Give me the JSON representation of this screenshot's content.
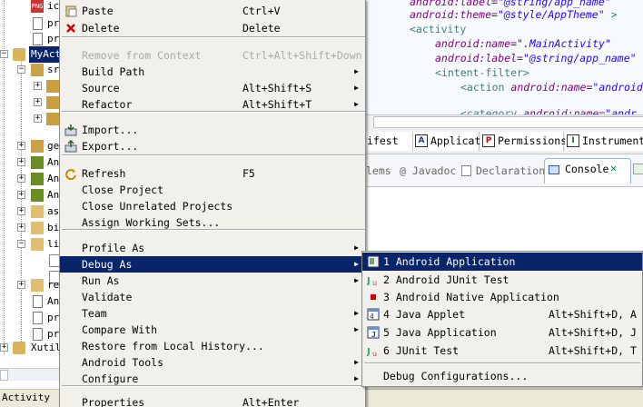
{
  "explorer": {
    "rows": [
      "ic",
      "pr",
      "pr",
      "MyAct",
      "sr",
      "",
      "",
      "",
      "ge",
      "An",
      "An",
      "An",
      "as",
      "bi",
      "li",
      "",
      "",
      "re",
      "An",
      "pr",
      "pr",
      "Xutil"
    ],
    "status_text": "Activity"
  },
  "editor": {
    "lines": [
      {
        "attr": "android:label=",
        "val": "\"@string/app_name\""
      },
      {
        "attr": "android:theme=",
        "val": "\"@style/AppTheme\"",
        "tail": " >"
      },
      {
        "tag": "<activity"
      },
      {
        "attr": "android:name=",
        "val": "\".MainActivity\""
      },
      {
        "attr": "android:label=",
        "val": "\"@string/app_name\"",
        "tail": " >"
      },
      {
        "tag": "<intent-filter>"
      },
      {
        "tag": "<action ",
        "attr": "android:name=",
        "val": "\"android"
      },
      {
        "tag": ""
      },
      {
        "tag": "<category ",
        "attr": "android:name=",
        "val": "\"andr"
      }
    ]
  },
  "manifest_tabs": [
    {
      "label": "ifest",
      "icon": ""
    },
    {
      "label": "Application",
      "icon": "A"
    },
    {
      "label": "Permissions",
      "icon": "P"
    },
    {
      "label": "Instrumentat",
      "icon": "I"
    }
  ],
  "console_tabs": [
    {
      "label": "lems"
    },
    {
      "label": "@ Javadoc"
    },
    {
      "label": "Declaration"
    },
    {
      "label": "Console"
    }
  ],
  "context_menu": {
    "items": [
      {
        "label": "Paste",
        "accel": "Ctrl+V",
        "icon": "paste-icon"
      },
      {
        "label": "Delete",
        "accel": "Delete",
        "icon": "delete-icon"
      },
      {
        "sep": true
      },
      {
        "label": "Remove from Context",
        "accel": "Ctrl+Alt+Shift+Down",
        "disabled": true
      },
      {
        "label": "Build Path",
        "submenu": true
      },
      {
        "label": "Source",
        "accel": "Alt+Shift+S",
        "submenu": true
      },
      {
        "label": "Refactor",
        "accel": "Alt+Shift+T",
        "submenu": true
      },
      {
        "sep": true
      },
      {
        "label": "Import...",
        "icon": "import-icon"
      },
      {
        "label": "Export...",
        "icon": "export-icon"
      },
      {
        "sep": true
      },
      {
        "label": "Refresh",
        "accel": "F5",
        "icon": "refresh-icon"
      },
      {
        "label": "Close Project"
      },
      {
        "label": "Close Unrelated Projects"
      },
      {
        "label": "Assign Working Sets..."
      },
      {
        "sep": true
      },
      {
        "label": "Profile As",
        "submenu": true
      },
      {
        "label": "Debug As",
        "submenu": true,
        "highlighted": true
      },
      {
        "label": "Run As",
        "submenu": true
      },
      {
        "label": "Validate"
      },
      {
        "label": "Team",
        "submenu": true
      },
      {
        "label": "Compare With",
        "submenu": true
      },
      {
        "label": "Restore from Local History..."
      },
      {
        "label": "Android Tools",
        "submenu": true
      },
      {
        "label": "Configure",
        "submenu": true
      },
      {
        "sep": true
      },
      {
        "label": "Properties",
        "accel": "Alt+Enter"
      }
    ]
  },
  "debug_submenu": {
    "items": [
      {
        "label": "1 Android Application",
        "icon": "android-app-icon",
        "highlighted": true
      },
      {
        "label": "2 Android JUnit Test",
        "icon": "junit-icon"
      },
      {
        "label": "3 Android Native Application",
        "icon": "native-app-icon"
      },
      {
        "label": "4 Java Applet",
        "accel": "Alt+Shift+D, A",
        "icon": "applet-icon"
      },
      {
        "label": "5 Java Application",
        "accel": "Alt+Shift+D, J",
        "icon": "java-app-icon"
      },
      {
        "label": "6 JUnit Test",
        "accel": "Alt+Shift+D, T",
        "icon": "junit-icon"
      },
      {
        "sep": true
      },
      {
        "label": "Debug Configurations..."
      }
    ]
  },
  "colors": {
    "highlight": "#0a246a",
    "menu_bg": "#f1f0ea",
    "xml_attr": "#7f007f",
    "xml_value": "#2a00ff",
    "xml_tag": "#3f7f7f"
  }
}
